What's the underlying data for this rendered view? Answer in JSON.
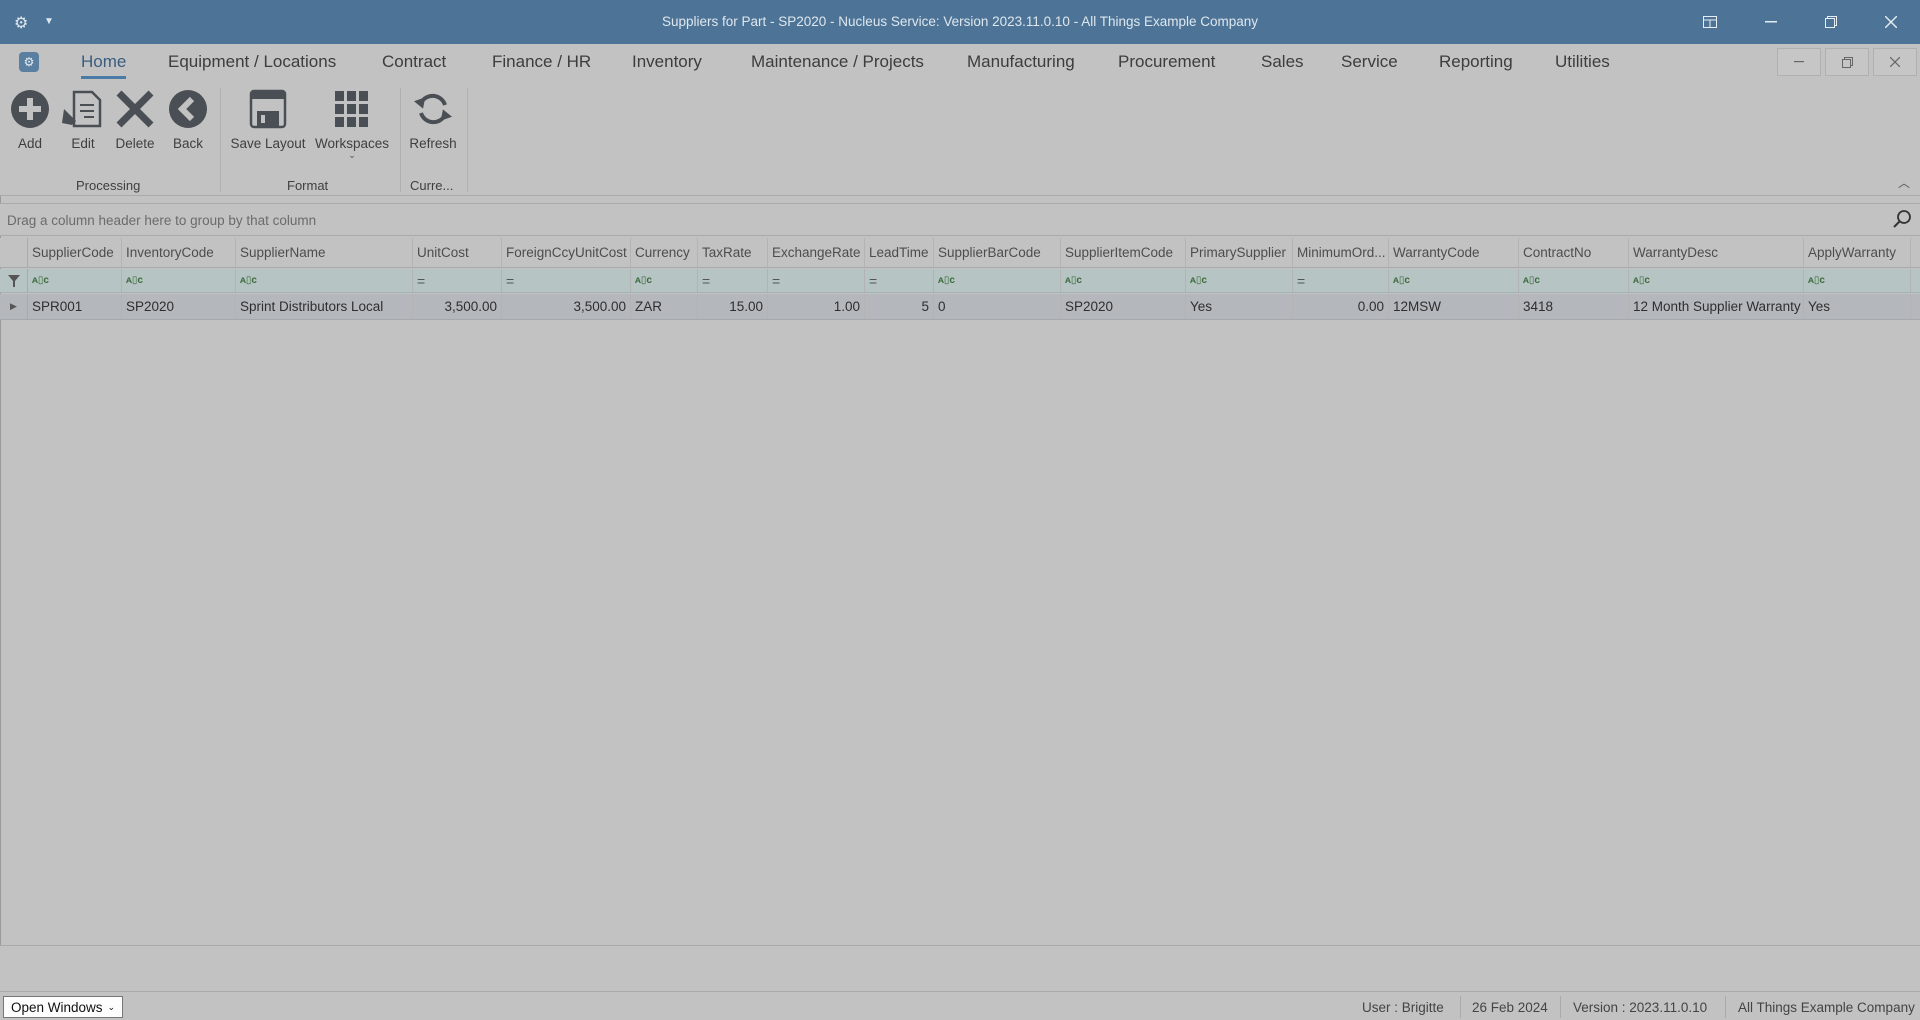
{
  "window": {
    "title": "Suppliers for Part - SP2020 - Nucleus Service: Version 2023.11.0.10 - All Things Example Company"
  },
  "menu": {
    "tabs": [
      "Home",
      "Equipment / Locations",
      "Contract",
      "Finance / HR",
      "Inventory",
      "Maintenance / Projects",
      "Manufacturing",
      "Procurement",
      "Sales",
      "Service",
      "Reporting",
      "Utilities"
    ],
    "active": "Home"
  },
  "ribbon": {
    "buttons": {
      "add": "Add",
      "edit": "Edit",
      "delete": "Delete",
      "back": "Back",
      "save_layout": "Save Layout",
      "workspaces": "Workspaces",
      "refresh": "Refresh"
    },
    "groups": {
      "processing": "Processing",
      "format": "Format",
      "current": "Curre..."
    }
  },
  "grid": {
    "group_hint": "Drag a column header here to group by that column",
    "columns": [
      "SupplierCode",
      "InventoryCode",
      "SupplierName",
      "UnitCost",
      "ForeignCcyUnitCost",
      "Currency",
      "TaxRate",
      "ExchangeRate",
      "LeadTime",
      "SupplierBarCode",
      "SupplierItemCode",
      "PrimarySupplier",
      "MinimumOrd...",
      "WarrantyCode",
      "ContractNo",
      "WarrantyDesc",
      "ApplyWarranty"
    ],
    "filter_types": [
      "text",
      "text",
      "text",
      "num",
      "num",
      "text",
      "num",
      "num",
      "num",
      "text",
      "text",
      "text",
      "num",
      "text",
      "text",
      "text",
      "text"
    ],
    "text_filter_glyph": "ᴀ▯ᴄ",
    "num_filter_glyph": "=",
    "rows": [
      [
        "SPR001",
        "SP2020",
        "Sprint Distributors Local",
        "3,500.00",
        "3,500.00",
        "ZAR",
        "15.00",
        "1.00",
        "5",
        "0",
        "SP2020",
        "Yes",
        "0.00",
        "12MSW",
        "3418",
        "12 Month Supplier Warranty",
        "Yes"
      ]
    ]
  },
  "status": {
    "open_windows": "Open Windows",
    "user": "User : Brigitte",
    "date": "26 Feb 2024",
    "version": "Version : 2023.11.0.10",
    "company": "All Things Example Company"
  },
  "colors": {
    "titlebar": "#4d7497",
    "background": "#c2c2c2",
    "filter_row": "#b6c4c4",
    "selected_row": "#b4b8bd",
    "accent": "#4a7aa6"
  }
}
